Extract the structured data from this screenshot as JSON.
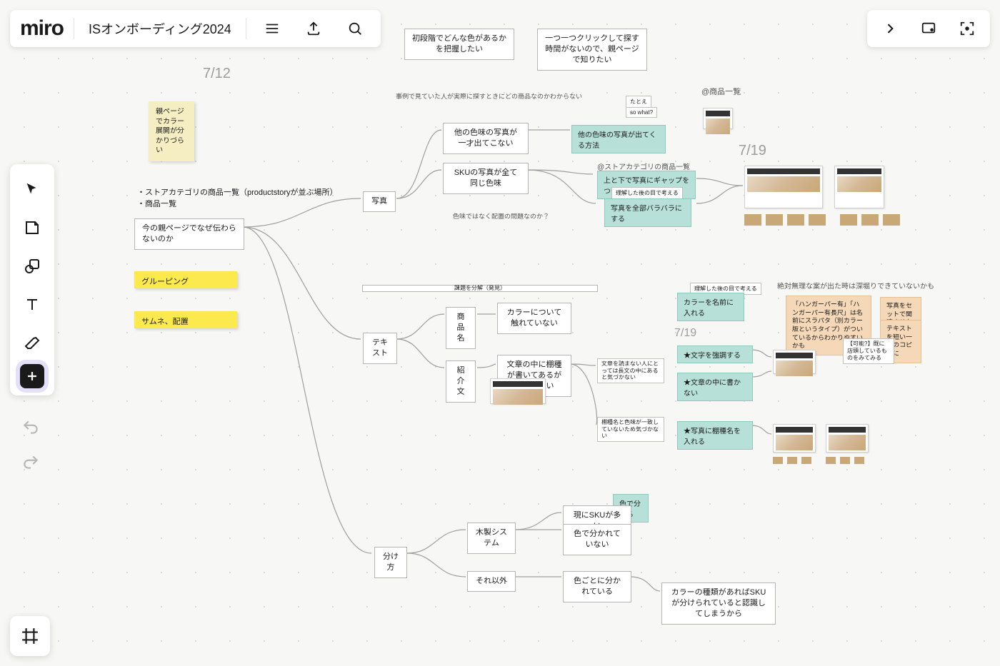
{
  "app": {
    "logo": "miro",
    "board_title": "ISオンボーディング2024"
  },
  "dates": {
    "d1": "7/12",
    "d2": "7/19",
    "d3": "7/19"
  },
  "notes": {
    "sticky1": "親ページでカラー展開が分かりづらい"
  },
  "text": {
    "list1": "・ストアカテゴリの商品一覧（productstoryが並ぶ場所）",
    "list2": "・商品一覧",
    "caption_products": "@商品一覧",
    "caption_store": "@ストアカテゴリの商品一覧",
    "caption_case": "事例で見ていた人が実際に探すときにどの商品なのかわからない",
    "caption_arrange": "色味ではなく配置の問題なのか？",
    "caption_long_header": "課題を分解（発見）",
    "caption_absurd": "絶対無理な案が出た時は深堀りできていないかも"
  },
  "nodes": {
    "top_left": "初段階でどんな色があるかを把握したい",
    "top_right": "一つ一つクリックして探す時間がないので、親ページで知りたい",
    "root": "今の親ページでなぜ伝わらないのか",
    "photo": "写真",
    "photo_a": "他の色味の写真が一才出てこない",
    "photo_b": "SKUの写真が全て同じ色味",
    "textn": "テキスト",
    "name": "商品名",
    "intro": "紹介文",
    "name_a": "カラーについて触れていない",
    "intro_a": "文章の中に棚種が書いてあるが気づかない",
    "intro_small": "文章を読まない人にとっては長文の中にあると気づかない",
    "intro_small2": "棚種名と色味が一致していないため気づかない",
    "split": "分け方",
    "wood": "木製システム",
    "other": "それ以外",
    "wood_a": "現にSKUが多い",
    "wood_b": "色で分かれていない",
    "other_a": "色ごとに分かれている",
    "other_b": "カラーの種類があればSKUが分けられていると認識してしまうから",
    "small_tag1": "たとえ",
    "small_tag2": "so what?",
    "peach1": "「ハンガーパー有」「ハンガーパー有長尺」は名前にスラパタ（別カラー版というタイプ）がついているからわかりやすいかも",
    "peach2": "写真をセットで関連させたい？",
    "peach3": "テキストを短い一言のコピーに",
    "whitebox1": "【可能?】既に店頭しているものをみてみる"
  },
  "yellow": {
    "grouping": "グルーピング",
    "thumb": "サムネ、配置"
  },
  "teal": {
    "method": "他の色味の写真が出てくる方法",
    "gap": "上と下で写真にギャップをつける?",
    "shuffle": "写真を全部バラバラにする",
    "colorname": "カラーを名前に入れる",
    "emph": "★文字を強調する",
    "inline": "★文章の中に書かない",
    "photoname": "★写真に棚種名を入れる",
    "bycolor": "色で分ける"
  },
  "labels": {
    "after_understand": "理解した後の目で考える"
  }
}
